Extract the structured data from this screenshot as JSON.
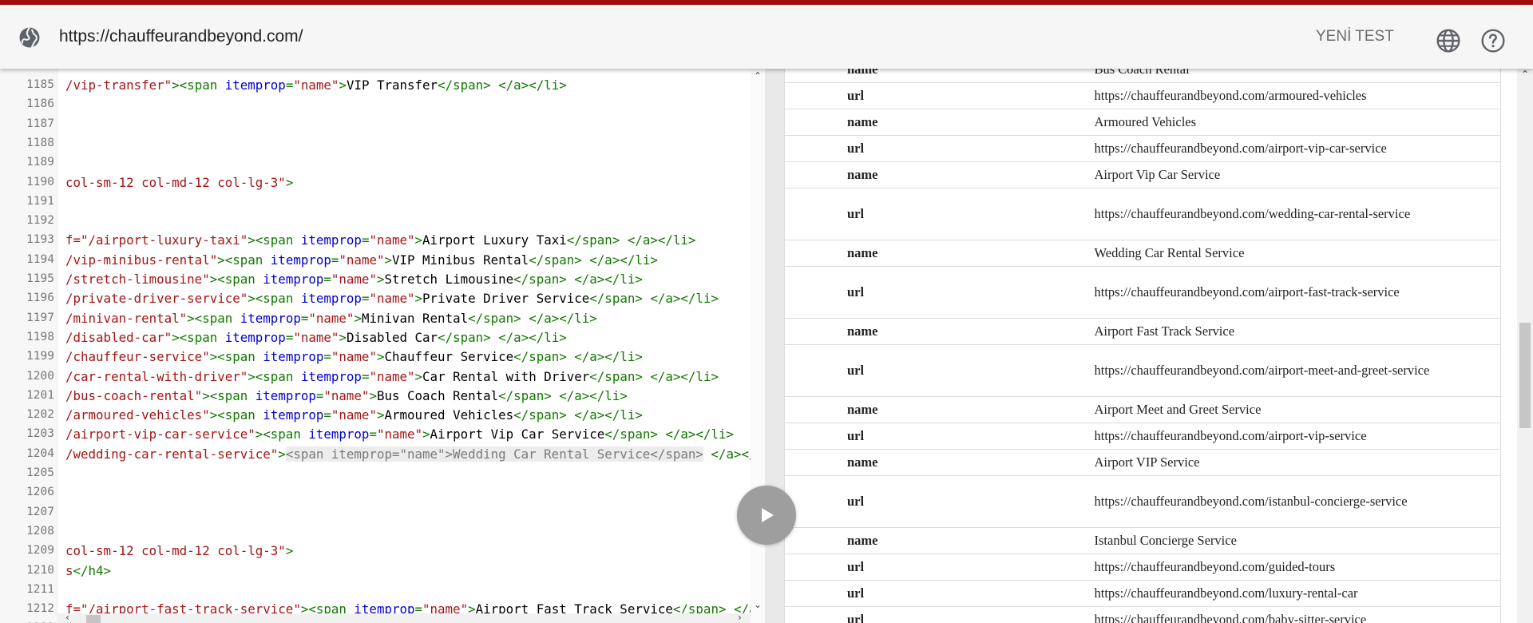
{
  "toolbar": {
    "url": "https://chauffeurandbeyond.com/",
    "new_test_label": "YENİ TEST"
  },
  "editor": {
    "lines": [
      {
        "n": "1185",
        "parts": [
          [
            "s",
            "/vip-transfer\""
          ],
          [
            "t",
            "><span "
          ],
          [
            "a",
            "itemprop"
          ],
          [
            "t",
            "="
          ],
          [
            "s",
            "\"name\""
          ],
          [
            "t",
            ">"
          ],
          [
            "x",
            "VIP Transfer"
          ],
          [
            "t",
            "</span> </a></li>"
          ]
        ]
      },
      {
        "n": "1186",
        "parts": []
      },
      {
        "n": "1187",
        "parts": []
      },
      {
        "n": "1188",
        "parts": []
      },
      {
        "n": "1189",
        "parts": []
      },
      {
        "n": "1190",
        "parts": [
          [
            "s",
            "col-sm-12 col-md-12 col-lg-3\""
          ],
          [
            "t",
            ">"
          ]
        ]
      },
      {
        "n": "1191",
        "parts": []
      },
      {
        "n": "1192",
        "parts": []
      },
      {
        "n": "1193",
        "parts": [
          [
            "s",
            "f=\"/airport-luxury-taxi\""
          ],
          [
            "t",
            "><span "
          ],
          [
            "a",
            "itemprop"
          ],
          [
            "t",
            "="
          ],
          [
            "s",
            "\"name\""
          ],
          [
            "t",
            ">"
          ],
          [
            "x",
            "Airport Luxury Taxi"
          ],
          [
            "t",
            "</span> </a></li>"
          ]
        ]
      },
      {
        "n": "1194",
        "parts": [
          [
            "s",
            "/vip-minibus-rental\""
          ],
          [
            "t",
            "><span "
          ],
          [
            "a",
            "itemprop"
          ],
          [
            "t",
            "="
          ],
          [
            "s",
            "\"name\""
          ],
          [
            "t",
            ">"
          ],
          [
            "x",
            "VIP Minibus Rental"
          ],
          [
            "t",
            "</span> </a></li>"
          ]
        ]
      },
      {
        "n": "1195",
        "parts": [
          [
            "s",
            "/stretch-limousine\""
          ],
          [
            "t",
            "><span "
          ],
          [
            "a",
            "itemprop"
          ],
          [
            "t",
            "="
          ],
          [
            "s",
            "\"name\""
          ],
          [
            "t",
            ">"
          ],
          [
            "x",
            "Stretch Limousine"
          ],
          [
            "t",
            "</span> </a></li>"
          ]
        ]
      },
      {
        "n": "1196",
        "parts": [
          [
            "s",
            "/private-driver-service\""
          ],
          [
            "t",
            "><span "
          ],
          [
            "a",
            "itemprop"
          ],
          [
            "t",
            "="
          ],
          [
            "s",
            "\"name\""
          ],
          [
            "t",
            ">"
          ],
          [
            "x",
            "Private Driver Service"
          ],
          [
            "t",
            "</span> </a></li>"
          ]
        ]
      },
      {
        "n": "1197",
        "parts": [
          [
            "s",
            "/minivan-rental\""
          ],
          [
            "t",
            "><span "
          ],
          [
            "a",
            "itemprop"
          ],
          [
            "t",
            "="
          ],
          [
            "s",
            "\"name\""
          ],
          [
            "t",
            ">"
          ],
          [
            "x",
            "Minivan Rental"
          ],
          [
            "t",
            "</span> </a></li>"
          ]
        ]
      },
      {
        "n": "1198",
        "parts": [
          [
            "s",
            "/disabled-car\""
          ],
          [
            "t",
            "><span "
          ],
          [
            "a",
            "itemprop"
          ],
          [
            "t",
            "="
          ],
          [
            "s",
            "\"name\""
          ],
          [
            "t",
            ">"
          ],
          [
            "x",
            "Disabled Car"
          ],
          [
            "t",
            "</span> </a></li>"
          ]
        ]
      },
      {
        "n": "1199",
        "parts": [
          [
            "s",
            "/chauffeur-service\""
          ],
          [
            "t",
            "><span "
          ],
          [
            "a",
            "itemprop"
          ],
          [
            "t",
            "="
          ],
          [
            "s",
            "\"name\""
          ],
          [
            "t",
            ">"
          ],
          [
            "x",
            "Chauffeur Service"
          ],
          [
            "t",
            "</span> </a></li>"
          ]
        ]
      },
      {
        "n": "1200",
        "parts": [
          [
            "s",
            "/car-rental-with-driver\""
          ],
          [
            "t",
            "><span "
          ],
          [
            "a",
            "itemprop"
          ],
          [
            "t",
            "="
          ],
          [
            "s",
            "\"name\""
          ],
          [
            "t",
            ">"
          ],
          [
            "x",
            "Car Rental with Driver"
          ],
          [
            "t",
            "</span> </a></li>"
          ]
        ]
      },
      {
        "n": "1201",
        "parts": [
          [
            "s",
            "/bus-coach-rental\""
          ],
          [
            "t",
            "><span "
          ],
          [
            "a",
            "itemprop"
          ],
          [
            "t",
            "="
          ],
          [
            "s",
            "\"name\""
          ],
          [
            "t",
            ">"
          ],
          [
            "x",
            "Bus Coach Rental"
          ],
          [
            "t",
            "</span> </a></li>"
          ]
        ]
      },
      {
        "n": "1202",
        "parts": [
          [
            "s",
            "/armoured-vehicles\""
          ],
          [
            "t",
            "><span "
          ],
          [
            "a",
            "itemprop"
          ],
          [
            "t",
            "="
          ],
          [
            "s",
            "\"name\""
          ],
          [
            "t",
            ">"
          ],
          [
            "x",
            "Armoured Vehicles"
          ],
          [
            "t",
            "</span> </a></li>"
          ]
        ]
      },
      {
        "n": "1203",
        "parts": [
          [
            "s",
            "/airport-vip-car-service\""
          ],
          [
            "t",
            "><span "
          ],
          [
            "a",
            "itemprop"
          ],
          [
            "t",
            "="
          ],
          [
            "s",
            "\"name\""
          ],
          [
            "t",
            ">"
          ],
          [
            "x",
            "Airport Vip Car Service"
          ],
          [
            "t",
            "</span> </a></li>"
          ]
        ]
      },
      {
        "n": "1204",
        "parts": [
          [
            "s",
            "/wedding-car-rental-service\""
          ],
          [
            "t",
            ">"
          ],
          [
            "h",
            "<span itemprop=\"name\">Wedding Car Rental Service</span>"
          ],
          [
            "t",
            " </a></"
          ]
        ]
      },
      {
        "n": "1205",
        "parts": []
      },
      {
        "n": "1206",
        "parts": []
      },
      {
        "n": "1207",
        "parts": []
      },
      {
        "n": "1208",
        "parts": []
      },
      {
        "n": "1209",
        "parts": [
          [
            "s",
            "col-sm-12 col-md-12 col-lg-3\""
          ],
          [
            "t",
            ">"
          ]
        ]
      },
      {
        "n": "1210",
        "parts": [
          [
            "s",
            "s"
          ],
          [
            "t",
            "</h4>"
          ]
        ]
      },
      {
        "n": "1211",
        "parts": []
      },
      {
        "n": "1212",
        "parts": [
          [
            "s",
            "f=\"/airport-fast-track-service\""
          ],
          [
            "t",
            "><span "
          ],
          [
            "a",
            "itemprop"
          ],
          [
            "t",
            "="
          ],
          [
            "s",
            "\"name\""
          ],
          [
            "t",
            ">"
          ],
          [
            "x",
            "Airport Fast Track Service"
          ],
          [
            "t",
            "</span> </a"
          ]
        ]
      },
      {
        "n": "1213",
        "parts": []
      }
    ]
  },
  "results": {
    "rows": [
      {
        "k": "name",
        "v": "Bus Coach Rental",
        "h": 24
      },
      {
        "k": "url",
        "v": "https://chauffeurandbeyond.com/armoured-vehicles",
        "h": 33
      },
      {
        "k": "name",
        "v": "Armoured Vehicles",
        "h": 33
      },
      {
        "k": "url",
        "v": "https://chauffeurandbeyond.com/airport-vip-car-service",
        "h": 33
      },
      {
        "k": "name",
        "v": "Airport Vip Car Service",
        "h": 33
      },
      {
        "k": "url",
        "v": "https://chauffeurandbeyond.com/wedding-car-rental-service",
        "h": 65
      },
      {
        "k": "name",
        "v": "Wedding Car Rental Service",
        "h": 33
      },
      {
        "k": "url",
        "v": "https://chauffeurandbeyond.com/airport-fast-track-service",
        "h": 65
      },
      {
        "k": "name",
        "v": "Airport Fast Track Service",
        "h": 33
      },
      {
        "k": "url",
        "v": "https://chauffeurandbeyond.com/airport-meet-and-greet-service",
        "h": 65
      },
      {
        "k": "name",
        "v": "Airport Meet and Greet Service",
        "h": 33
      },
      {
        "k": "url",
        "v": "https://chauffeurandbeyond.com/airport-vip-service",
        "h": 33
      },
      {
        "k": "name",
        "v": "Airport VIP Service",
        "h": 33
      },
      {
        "k": "url",
        "v": "https://chauffeurandbeyond.com/istanbul-concierge-service",
        "h": 65
      },
      {
        "k": "name",
        "v": "Istanbul Concierge Service",
        "h": 33
      },
      {
        "k": "url",
        "v": "https://chauffeurandbeyond.com/guided-tours",
        "h": 33
      },
      {
        "k": "url",
        "v": "https://chauffeurandbeyond.com/luxury-rental-car",
        "h": 33
      },
      {
        "k": "url",
        "v": "https://chauffeurandbeyond.com/baby-sitter-service",
        "h": 33
      }
    ]
  },
  "icons": {
    "site": "globe-icon",
    "language": "language-globe-icon",
    "help": "help-icon",
    "play": "play-icon"
  },
  "colors": {
    "accent": "#a10b0b",
    "code_string": "#a31515",
    "code_tag": "#117700",
    "code_attr": "#0000cc"
  }
}
